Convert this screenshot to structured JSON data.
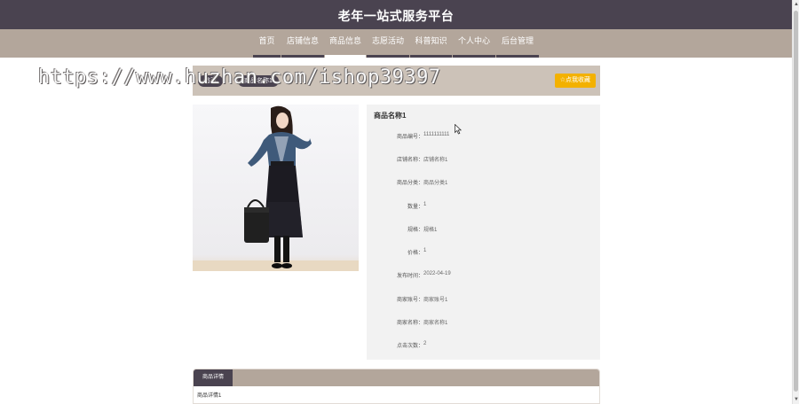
{
  "site": {
    "title": "老年一站式服务平台"
  },
  "nav": {
    "items": [
      {
        "label": "首页"
      },
      {
        "label": "店铺信息"
      },
      {
        "label": "商品信息"
      },
      {
        "label": "志愿活动"
      },
      {
        "label": "科普知识"
      },
      {
        "label": "个人中心"
      },
      {
        "label": "后台管理"
      }
    ],
    "active_index": 2
  },
  "breadcrumb": {
    "items": [
      {
        "label": "首页"
      },
      {
        "label": "商品名称1"
      }
    ]
  },
  "favorite_button": {
    "label": "☆点我收藏"
  },
  "watermark": {
    "text": "https://www.huzhan.com/ishop39397"
  },
  "product": {
    "name": "商品名称1",
    "fields": [
      {
        "label": "商品编号：",
        "value": "1111111111"
      },
      {
        "label": "店铺名称：",
        "value": "店铺名称1"
      },
      {
        "label": "商品分类：",
        "value": "商品分类1"
      },
      {
        "label": "数量：",
        "value": "1"
      },
      {
        "label": "规格：",
        "value": "规格1"
      },
      {
        "label": "价格：",
        "value": "1"
      },
      {
        "label": "发布时间：",
        "value": "2022-04-19"
      },
      {
        "label": "商家账号：",
        "value": "商家账号1"
      },
      {
        "label": "商家名称：",
        "value": "商家名称1"
      },
      {
        "label": "点击次数：",
        "value": "2"
      }
    ]
  },
  "details": {
    "tab_label": "商品详情",
    "content": "商品详情1"
  },
  "colors": {
    "header_bg": "#4a4350",
    "nav_bg": "#b3a69b",
    "panel_bg": "#f2f2f2",
    "accent": "#f3b100"
  }
}
